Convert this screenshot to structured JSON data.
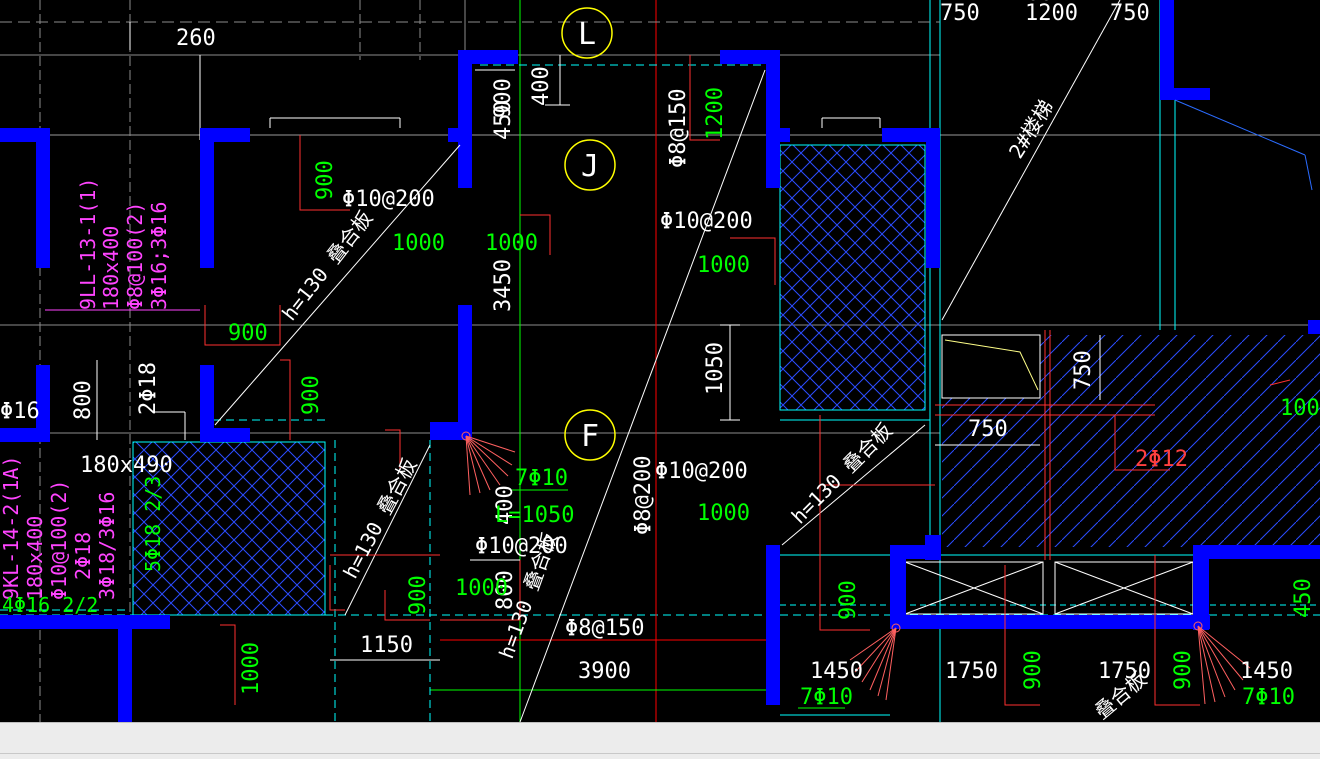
{
  "colors": {
    "background": "#000000",
    "wall": "#0000ff",
    "dimension": "#ffffff",
    "rebar_text": "#ffffff",
    "length_text": "#00ff00",
    "beam_label": "#ff00ff",
    "rebar_line": "#ff0000",
    "hatch": "#0000ff",
    "axis_bubble": "#ffff00",
    "grid": "#00ffff",
    "status_bar": "#ececec"
  },
  "axis_bubbles": [
    {
      "label": "L"
    },
    {
      "label": "J"
    },
    {
      "label": "F"
    }
  ],
  "dimensions": [
    {
      "id": "dim-260",
      "text": "260"
    },
    {
      "id": "dim-750-top",
      "text": "750"
    },
    {
      "id": "dim-1200-top",
      "text": "1200"
    },
    {
      "id": "dim-750-top2",
      "text": "750"
    },
    {
      "id": "dim-400",
      "text": "400"
    },
    {
      "id": "dim-900-shaft",
      "text": "900"
    },
    {
      "id": "dim-450",
      "text": "450"
    },
    {
      "id": "dim-3450",
      "text": "3450"
    },
    {
      "id": "dim-1050",
      "text": "1050"
    },
    {
      "id": "dim-800-left",
      "text": "800"
    },
    {
      "id": "dim-750-right",
      "text": "750"
    },
    {
      "id": "dim-1150",
      "text": "1150"
    },
    {
      "id": "dim-1200-bottom",
      "text": "1200"
    },
    {
      "id": "dim-3900",
      "text": "3900"
    },
    {
      "id": "dim-1450-left",
      "text": "1450"
    },
    {
      "id": "dim-1750-a",
      "text": "1750"
    },
    {
      "id": "dim-1750-b",
      "text": "1750"
    },
    {
      "id": "dim-1450-right",
      "text": "1450"
    },
    {
      "id": "dim-180x490",
      "text": "180x490"
    },
    {
      "id": "dim-800-mid",
      "text": "800"
    },
    {
      "id": "dim-450-b",
      "text": "450"
    },
    {
      "id": "dim-450-c",
      "text": "450"
    },
    {
      "id": "dim-400-vert",
      "text": "400"
    }
  ],
  "rebar_labels": [
    {
      "id": "rebar-phi10-200-a",
      "text": "Φ10@200"
    },
    {
      "id": "rebar-phi10-200-b",
      "text": "Φ10@200"
    },
    {
      "id": "rebar-phi10-200-c",
      "text": "Φ10@200"
    },
    {
      "id": "rebar-phi10-200-d",
      "text": "Φ10@200"
    },
    {
      "id": "rebar-phi8-150-v",
      "text": "Φ8@150"
    },
    {
      "id": "rebar-phi8-150-h",
      "text": "Φ8@150"
    },
    {
      "id": "rebar-phi8-200-v",
      "text": "Φ8@200"
    },
    {
      "id": "rebar-2phi12",
      "text": "2Φ12"
    },
    {
      "id": "rebar-phi16",
      "text": "Φ16"
    },
    {
      "id": "rebar-2phi18",
      "text": "2Φ18"
    }
  ],
  "lengths": [
    {
      "id": "len-900-a",
      "text": "900"
    },
    {
      "id": "len-1000-a",
      "text": "1000"
    },
    {
      "id": "len-1000-b",
      "text": "1000"
    },
    {
      "id": "len-1200",
      "text": "1200"
    },
    {
      "id": "len-1000-c",
      "text": "1000"
    },
    {
      "id": "len-900-b",
      "text": "900"
    },
    {
      "id": "len-900-c",
      "text": "900"
    },
    {
      "id": "len-1000-d",
      "text": "1000"
    },
    {
      "id": "len-1000-e",
      "text": "1000"
    },
    {
      "id": "len-1000-f",
      "text": "1000"
    },
    {
      "id": "len-1000-g",
      "text": "1000"
    },
    {
      "id": "len-900-d",
      "text": "900"
    },
    {
      "id": "len-900-e",
      "text": "900"
    },
    {
      "id": "len-900-f",
      "text": "900"
    },
    {
      "id": "len-900-g",
      "text": "900"
    },
    {
      "id": "len-450",
      "text": "450"
    },
    {
      "id": "len-1000-vert",
      "text": "1000"
    },
    {
      "id": "len-1000-right",
      "text": "1000"
    }
  ],
  "stirrup_notes": [
    {
      "id": "note-7phi10-a",
      "text": "7Φ10"
    },
    {
      "id": "note-l1050-a",
      "text": "L=1050"
    },
    {
      "id": "note-7phi10-b",
      "text": "7Φ10"
    },
    {
      "id": "note-7phi10-c",
      "text": "7Φ10"
    }
  ],
  "slab_labels": [
    {
      "id": "slab-h130-a",
      "text": "h=130 叠合板"
    },
    {
      "id": "slab-h130-b",
      "text": "h=130 叠合板"
    },
    {
      "id": "slab-h130-c",
      "text": "h=130 叠合板"
    },
    {
      "id": "slab-h130-d",
      "text": "h=130 叠合板"
    },
    {
      "id": "slab-diehe-a",
      "text": "叠合板"
    },
    {
      "id": "slab-diehe-b",
      "text": "叠合板"
    },
    {
      "id": "stair-label",
      "text": "2#楼梯"
    }
  ],
  "beam_labels": {
    "upper": [
      "9LL-13-1(1)",
      "180x400",
      "Φ8@100(2)",
      "3Φ16;3Φ16"
    ],
    "lower": [
      "9KL-14-2(1A)",
      "180x400",
      "Φ10@100(2)",
      "2Φ18",
      "3Φ18/3Φ16"
    ],
    "lower_extra": [
      "4Φ16 2/2",
      "5Φ18 2/3"
    ]
  }
}
